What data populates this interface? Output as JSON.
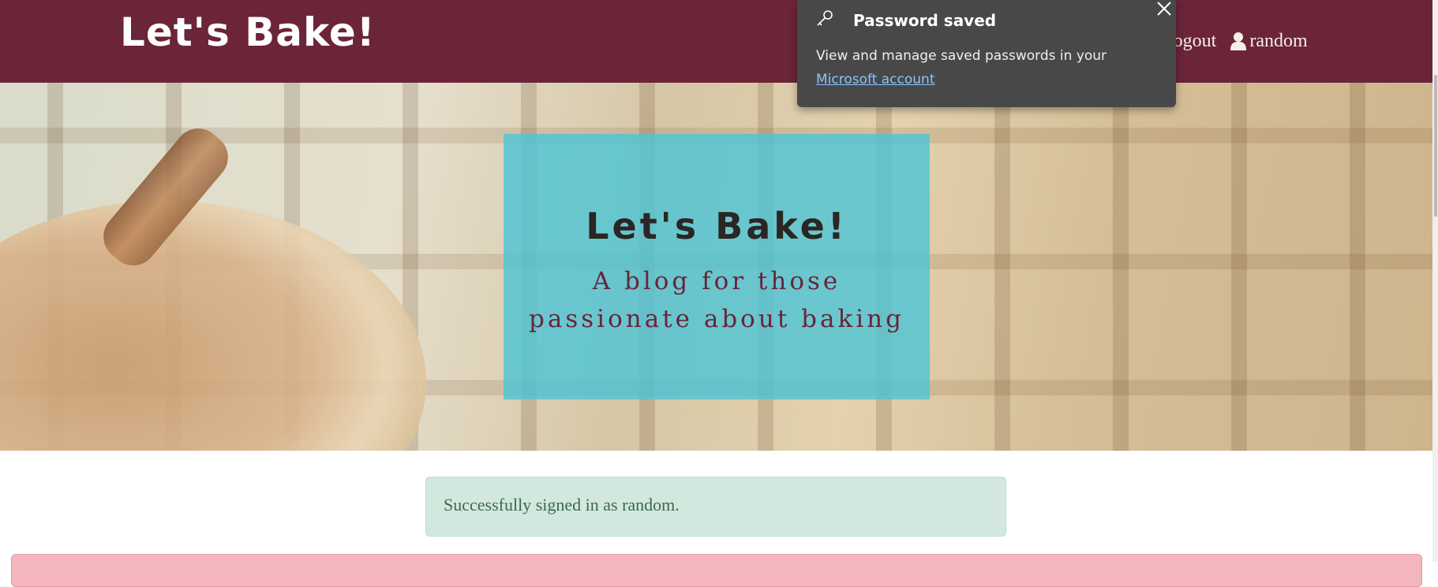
{
  "navbar": {
    "brand": "Let's Bake!",
    "logout_label": "Logout",
    "user_icon": "user-icon",
    "username": "random"
  },
  "hero": {
    "title": "Let's Bake!",
    "subtitle": "A blog for those passionate about baking"
  },
  "alerts": {
    "success_text": "Successfully signed in as random."
  },
  "toast": {
    "title": "Password saved",
    "body_text": "View and manage saved passwords in your",
    "link_text": "Microsoft account",
    "key_icon": "key-icon",
    "close_icon": "close-icon"
  },
  "colors": {
    "navbar": "#6b2438",
    "hero_card": "#4fc4d6",
    "success_bg": "#d2e8df",
    "danger_bg": "#f2b6bc",
    "toast_bg": "#484848"
  }
}
